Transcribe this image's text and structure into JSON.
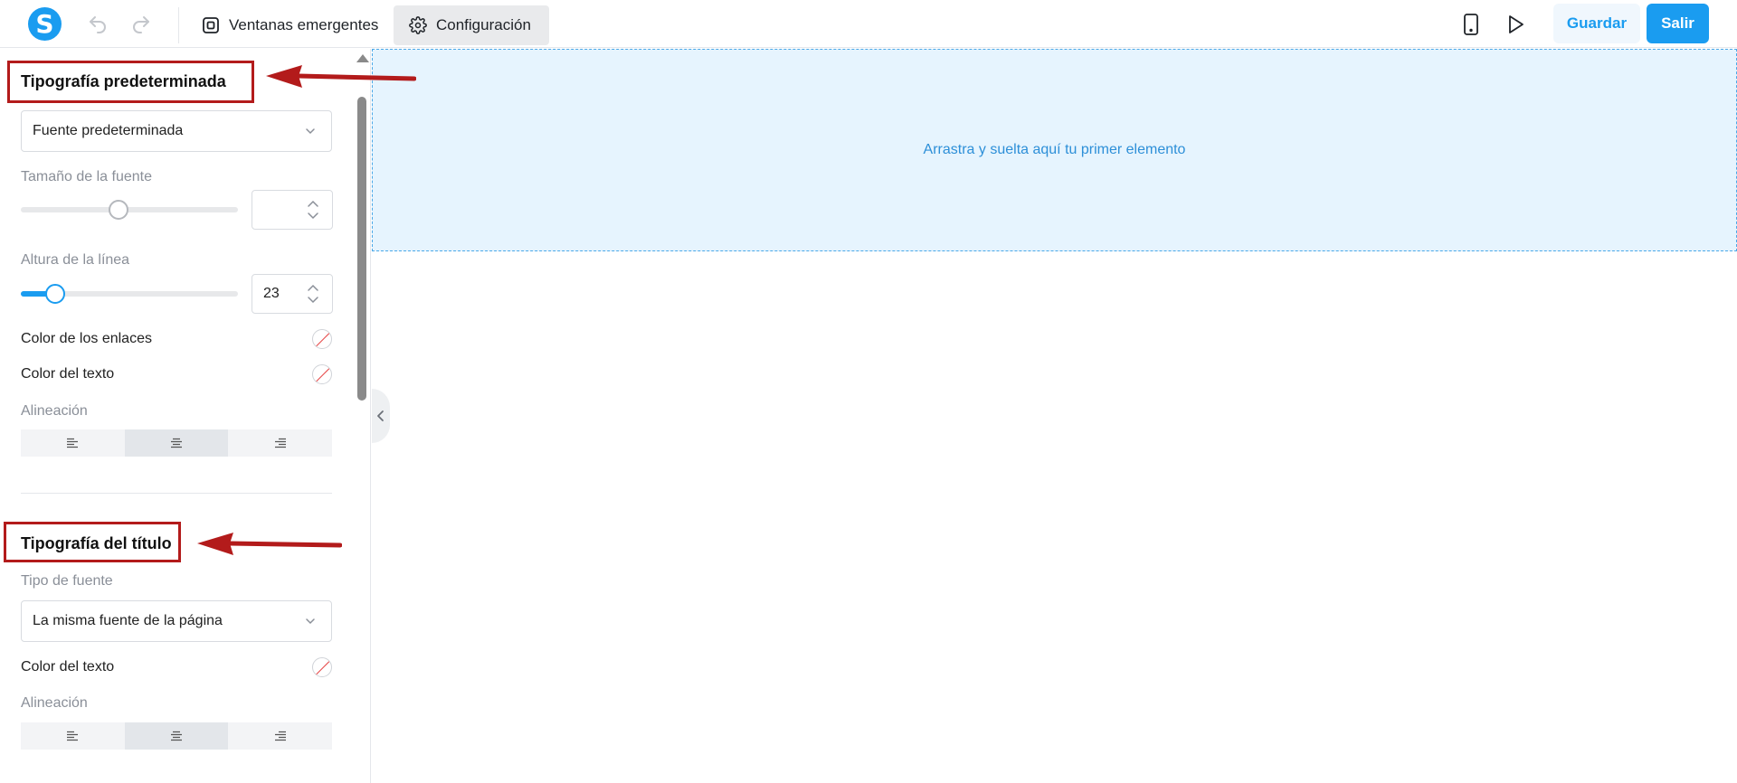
{
  "app": {
    "logo_letter": "S"
  },
  "toolbar": {
    "popups_label": "Ventanas emergentes",
    "config_label": "Configuración",
    "save_label": "Guardar",
    "exit_label": "Salir"
  },
  "sidebar": {
    "default_typography": {
      "title": "Tipografía predeterminada",
      "font_select_value": "Fuente predeterminada",
      "font_size_label": "Tamaño de la fuente",
      "font_size_value": "",
      "font_size_slider_fraction": 0.45,
      "line_height_label": "Altura de la línea",
      "line_height_value": "23",
      "line_height_slider_fraction": 0.16,
      "link_color_label": "Color de los enlaces",
      "text_color_label": "Color del texto",
      "alignment_label": "Alineación",
      "alignment_selected": "center"
    },
    "title_typography": {
      "title": "Tipografía del título",
      "font_type_label": "Tipo de fuente",
      "font_select_value": "La misma fuente de la página",
      "text_color_label": "Color del texto",
      "alignment_label": "Alineación",
      "alignment_selected": "center"
    }
  },
  "canvas": {
    "drop_text": "Arrastra y suelta aquí tu primer elemento"
  },
  "colors": {
    "accent": "#1a9cf0",
    "annotation": "#b31b1b",
    "drop_zone_bg": "#e6f4fe"
  }
}
